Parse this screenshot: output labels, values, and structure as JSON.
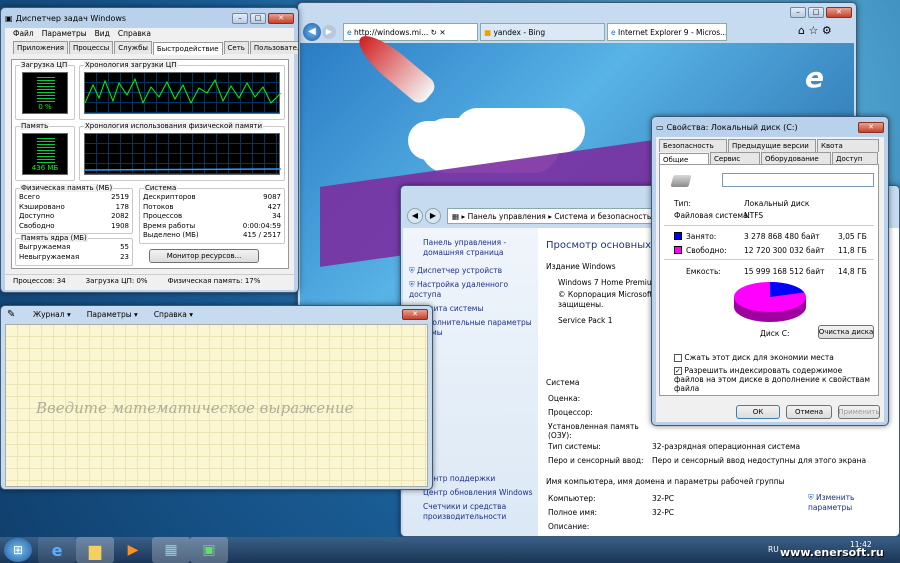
{
  "taskmgr": {
    "title": "Диспетчер задач Windows",
    "menu": [
      "Файл",
      "Параметры",
      "Вид",
      "Справка"
    ],
    "tabs": [
      "Приложения",
      "Процессы",
      "Службы",
      "Быстродействие",
      "Сеть",
      "Пользователи"
    ],
    "cpu_label": "Загрузка ЦП",
    "cpu_value": "0 %",
    "cpu_hist_label": "Хронология загрузки ЦП",
    "mem_label": "Память",
    "mem_value": "436 МБ",
    "mem_hist_label": "Хронология использования физической памяти",
    "phys": {
      "label": "Физическая память (МБ)",
      "rows": [
        [
          "Всего",
          "2519"
        ],
        [
          "Кэшировано",
          "178"
        ],
        [
          "Доступно",
          "2082"
        ],
        [
          "Свободно",
          "1908"
        ]
      ]
    },
    "kernel": {
      "label": "Память ядра (МБ)",
      "rows": [
        [
          "Выгружаемая",
          "55"
        ],
        [
          "Невыгружаемая",
          "23"
        ]
      ]
    },
    "system": {
      "label": "Система",
      "rows": [
        [
          "Дескрипторов",
          "9087"
        ],
        [
          "Потоков",
          "427"
        ],
        [
          "Процессов",
          "34"
        ],
        [
          "Время работы",
          "0:00:04:59"
        ],
        [
          "Выделено (МБ)",
          "415 / 2517"
        ]
      ]
    },
    "resmon_btn": "Монитор ресурсов...",
    "status": [
      "Процессов: 34",
      "Загрузка ЦП: 0%",
      "Физическая память: 17%"
    ]
  },
  "ie": {
    "tabs": [
      "http://windows.mi...",
      "yandex - Bing",
      "Internet Explorer 9 - Micros..."
    ]
  },
  "control": {
    "breadcrumb": [
      "Панель управления",
      "Система и безопасность"
    ],
    "left_links": [
      "Панель управления - домашняя страница",
      "Диспетчер устройств",
      "Настройка удаленного доступа",
      "Защита системы",
      "Дополнительные параметры системы"
    ],
    "see_also": [
      "Центр поддержки",
      "Центр обновления Windows",
      "Счетчики и средства производительности"
    ],
    "heading": "Просмотр основных све",
    "edition_label": "Издание Windows",
    "edition": [
      "Windows 7 Home Premium",
      "© Корпорация Microsoft (М",
      "защищены.",
      "Service Pack 1"
    ],
    "system_label": "Система",
    "sys_rows": [
      [
        "Оценка:",
        ""
      ],
      [
        "Процессор:",
        ""
      ],
      [
        "Установленная память (ОЗУ):",
        ""
      ],
      [
        "Тип системы:",
        "32-разрядная операционная система"
      ],
      [
        "Перо и сенсорный ввод:",
        "Перо и сенсорный ввод недоступны для этого экрана"
      ]
    ],
    "domain_label": "Имя компьютера, имя домена и параметры рабочей группы",
    "domain_rows": [
      [
        "Компьютер:",
        "32-PC"
      ],
      [
        "Полное имя:",
        "32-PC"
      ],
      [
        "Описание:",
        ""
      ]
    ],
    "change_link": "Изменить параметры"
  },
  "diskprops": {
    "title": "Свойства: Локальный диск (C:)",
    "tabs_top": [
      "Безопасность",
      "Предыдущие версии",
      "Квота"
    ],
    "tabs_bottom": [
      "Общие",
      "Сервис",
      "Оборудование",
      "Доступ"
    ],
    "name_value": "",
    "type_label": "Тип:",
    "type_value": "Локальный диск",
    "fs_label": "Файловая система:",
    "fs_value": "NTFS",
    "used_label": "Занято:",
    "used_bytes": "3 278 868 480 байт",
    "used_gb": "3,05 ГБ",
    "free_label": "Свободно:",
    "free_bytes": "12 720 300 032 байт",
    "free_gb": "11,8 ГБ",
    "cap_label": "Емкость:",
    "cap_bytes": "15 999 168 512 байт",
    "cap_gb": "14,8 ГБ",
    "used_fraction": 0.2,
    "disk_label": "Диск C:",
    "cleanup_btn": "Очистка диска",
    "compress": "Сжать этот диск для экономии места",
    "index": "Разрешить индексировать содержимое файлов на этом диске в дополнение к свойствам файла",
    "ok": "ОК",
    "cancel": "Отмена",
    "apply": "Применить",
    "colors": {
      "used": "#0000ff",
      "free": "#ff00ff"
    }
  },
  "math": {
    "menu": [
      "Журнал",
      "Параметры",
      "Справка"
    ],
    "prompt": "Введите математическое выражение"
  },
  "taskbar": {
    "lang": "RU",
    "time": "11:42"
  },
  "watermark": "www.enersoft.ru"
}
